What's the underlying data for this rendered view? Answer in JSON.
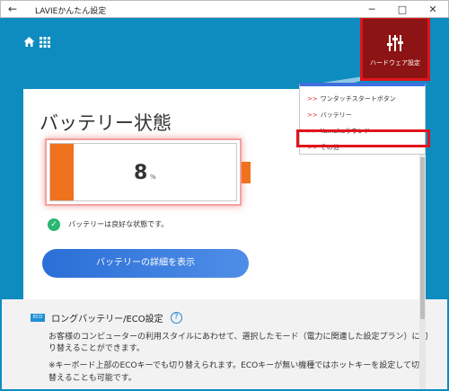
{
  "window": {
    "title": "LAVIEかんたん設定",
    "back_glyph": "←",
    "min_glyph": "─",
    "max_glyph": "□",
    "close_glyph": "✕"
  },
  "header": {
    "home_icon": "home-icon",
    "grid_icon": "grid-icon",
    "hardware_button_label": "ハードウェア設定",
    "hardware_icon": "sliders-icon"
  },
  "menu": {
    "arrow": ">>",
    "items": [
      {
        "label": "ワンタッチスタートボタン"
      },
      {
        "label": "バッテリー"
      },
      {
        "label": "Yamahaサウンド"
      },
      {
        "label": "その他"
      }
    ],
    "highlighted_index": 3
  },
  "battery": {
    "title": "バッテリー状態",
    "percent": "8",
    "unit": "%",
    "level_fraction": 0.08,
    "status_text": "バッテリーは良好な状態です。",
    "detail_button": "バッテリーの詳細を表示"
  },
  "eco": {
    "badge": "ECO",
    "title": "ロングバッテリー/ECO設定",
    "help": "?",
    "desc_lines": [
      "お客様のコンピューターの利用スタイルにあわせて、選択したモード（電力に関連した設定プラン）に切",
      "り替えることができます。",
      "※キーボード上部のECOキーでも切り替えられます。ECOキーが無い機種ではホットキーを設定して切り",
      "替えることも可能です。"
    ]
  },
  "colors": {
    "background": "#0e8cc0",
    "accent_red": "#e1141c",
    "battery_orange": "#f0711e",
    "button_blue": "#2a6fd6",
    "ok_green": "#2bb673"
  }
}
